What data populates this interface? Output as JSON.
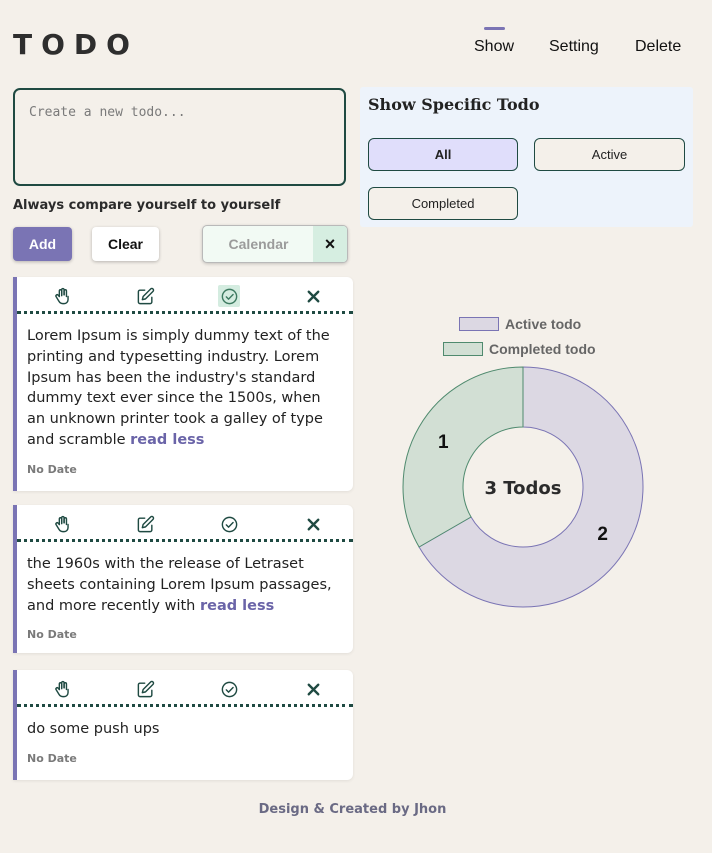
{
  "header": {
    "logo": "TODO",
    "nav": {
      "show": "Show",
      "setting": "Setting",
      "delete": "Delete"
    }
  },
  "composer": {
    "placeholder": "Create a new todo...",
    "motto": "Always compare yourself to yourself",
    "add_label": "Add",
    "clear_label": "Clear",
    "calendar_label": "Calendar",
    "calendar_close": "×"
  },
  "filter": {
    "title": "Show Specific Todo",
    "all": "All",
    "active": "Active",
    "completed": "Completed",
    "selected": "All"
  },
  "todos": [
    {
      "text": "Lorem Ipsum is simply dummy text of the printing and typesetting industry. Lorem Ipsum has been the industry's standard dummy text ever since the 1500s, when an unknown printer took a galley of type and scramble",
      "toggle": "read less",
      "date": "No Date"
    },
    {
      "text": "the 1960s with the release of Letraset sheets containing Lorem Ipsum passages, and more recently with",
      "toggle": "read less",
      "date": "No Date"
    },
    {
      "text": "do some push ups",
      "toggle": "",
      "date": "No Date"
    }
  ],
  "icons": {
    "drag": "hand-icon",
    "edit": "edit-icon",
    "done": "check-circle-icon",
    "delete": "close-icon"
  },
  "chart_data": {
    "type": "pie",
    "categories": [
      "Active todo",
      "Completed todo"
    ],
    "values": [
      2,
      1
    ],
    "center_label": "3 Todos",
    "colors": [
      "#dcd8e3",
      "#d2dfd4"
    ],
    "border_colors": [
      "#7a74b4",
      "#4f8a6e"
    ],
    "legend": "top"
  },
  "footer": {
    "credit": "Design & Created by Jhon"
  },
  "colors": {
    "accent": "#7a74b4",
    "dark_green": "#1f4a42",
    "background": "#f4f0ea"
  }
}
